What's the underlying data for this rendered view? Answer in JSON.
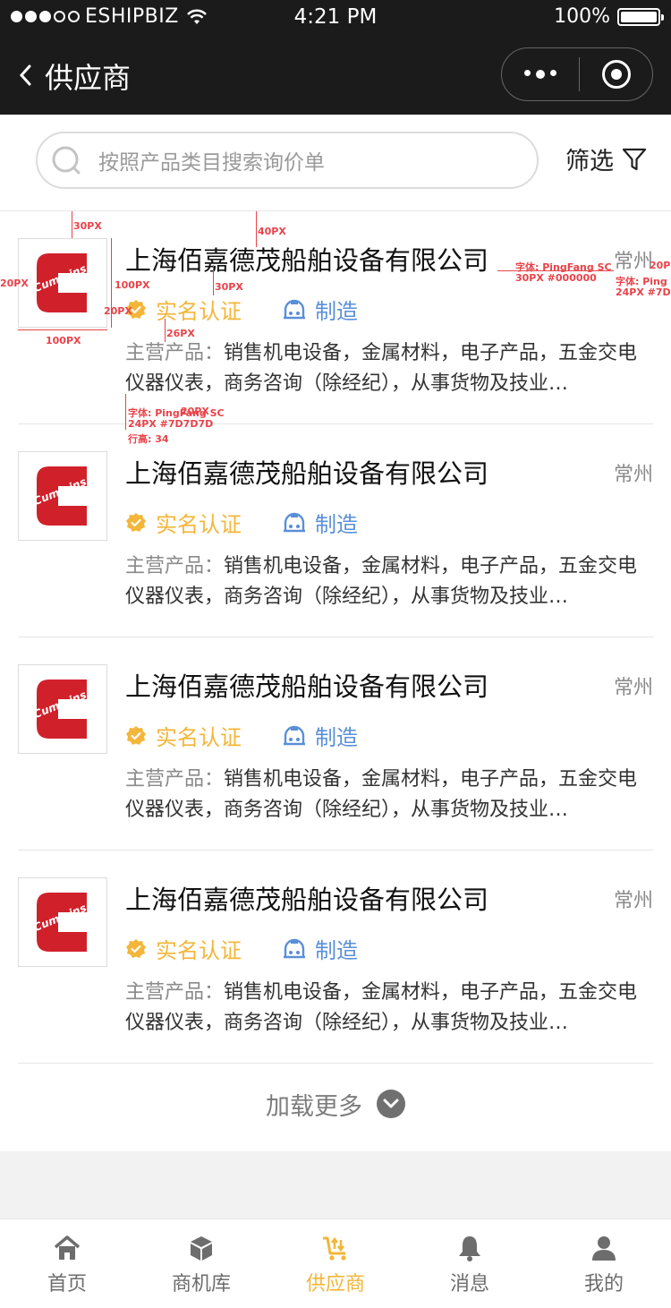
{
  "status_bar": {
    "carrier": "ESHIPBIZ",
    "time": "4:21 PM",
    "battery": "100%"
  },
  "nav": {
    "title": "供应商"
  },
  "search": {
    "placeholder": "按照产品类目搜索询价单",
    "filter_label": "筛选"
  },
  "suppliers": [
    {
      "logo": "Cummins",
      "name": "上海佰嘉德茂船舶设备有限公司",
      "city": "常州",
      "verified": "实名认证",
      "type": "制造",
      "desc_prefix": "主营产品：",
      "desc": "销售机电设备，金属材料，电子产品，五金交电仪器仪表，商务咨询（除经纪），从事货物及技业…"
    },
    {
      "logo": "Cummins",
      "name": "上海佰嘉德茂船舶设备有限公司",
      "city": "常州",
      "verified": "实名认证",
      "type": "制造",
      "desc_prefix": "主营产品：",
      "desc": "销售机电设备，金属材料，电子产品，五金交电仪器仪表，商务咨询（除经纪），从事货物及技业…"
    },
    {
      "logo": "Cummins",
      "name": "上海佰嘉德茂船舶设备有限公司",
      "city": "常州",
      "verified": "实名认证",
      "type": "制造",
      "desc_prefix": "主营产品：",
      "desc": "销售机电设备，金属材料，电子产品，五金交电仪器仪表，商务咨询（除经纪），从事货物及技业…"
    },
    {
      "logo": "Cummins",
      "name": "上海佰嘉德茂船舶设备有限公司",
      "city": "常州",
      "verified": "实名认证",
      "type": "制造",
      "desc_prefix": "主营产品：",
      "desc": "销售机电设备，金属材料，电子产品，五金交电仪器仪表，商务咨询（除经纪），从事货物及技业…"
    }
  ],
  "load_more": "加载更多",
  "annotations": {
    "a1": "30PX",
    "a2": "40PX",
    "a3": "100PX",
    "a4": "20PX",
    "a5": "20PX",
    "a6": "100PX",
    "a7": "30PX",
    "a8": "26PX",
    "a9": "字体: PingFang SC",
    "a10": "30PX #000000",
    "a11": "20P",
    "a12": "字体: Ping",
    "a13": "24PX #7D7",
    "a14": "字体: PingFang SC",
    "a15": "24PX #7D7D7D",
    "a16": "行高: 34",
    "a17": "20PX"
  },
  "tabs": [
    {
      "label": "首页",
      "icon": "home-icon",
      "active": false
    },
    {
      "label": "商机库",
      "icon": "cube-icon",
      "active": false
    },
    {
      "label": "供应商",
      "icon": "cart-icon",
      "active": true
    },
    {
      "label": "消息",
      "icon": "bell-icon",
      "active": false
    },
    {
      "label": "我的",
      "icon": "user-icon",
      "active": false
    }
  ],
  "colors": {
    "accent": "#f3b63a",
    "link_blue": "#5a8fd8",
    "brand_red": "#d0212b",
    "annotation_red": "#e8434a"
  }
}
